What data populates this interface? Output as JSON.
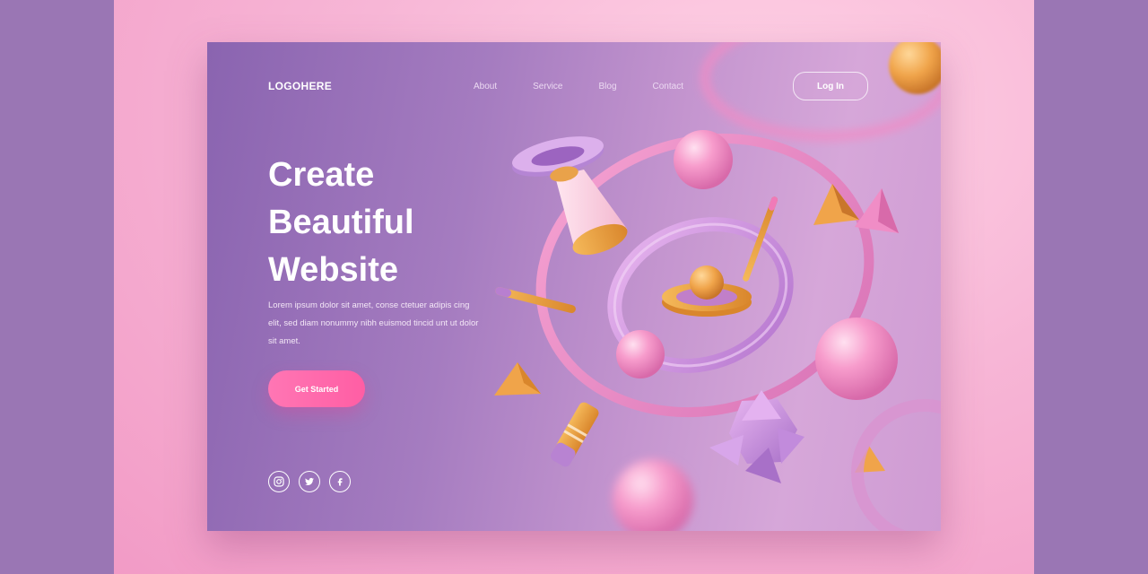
{
  "brand": {
    "logo_text": "LOGOHERE"
  },
  "nav": {
    "items": [
      {
        "label": "About"
      },
      {
        "label": "Service"
      },
      {
        "label": "Blog"
      },
      {
        "label": "Contact"
      }
    ],
    "login_label": "Log In"
  },
  "hero": {
    "headline": "Create\nBeautiful\nWebsite",
    "body": "Lorem ipsum dolor sit amet, conse ctetuer adipis cing elit, sed diam nonummy nibh euismod tincid unt ut dolor sit amet.",
    "cta_label": "Get Started"
  },
  "socials": [
    {
      "icon": "instagram-icon"
    },
    {
      "icon": "twitter-icon"
    },
    {
      "icon": "facebook-icon"
    }
  ],
  "colors": {
    "frame": "#9a76b4",
    "card_start": "#8a64b0",
    "card_end": "#d6a7d9",
    "accent_pink": "#ff5ea4",
    "accent_orange": "#f0a44a"
  }
}
